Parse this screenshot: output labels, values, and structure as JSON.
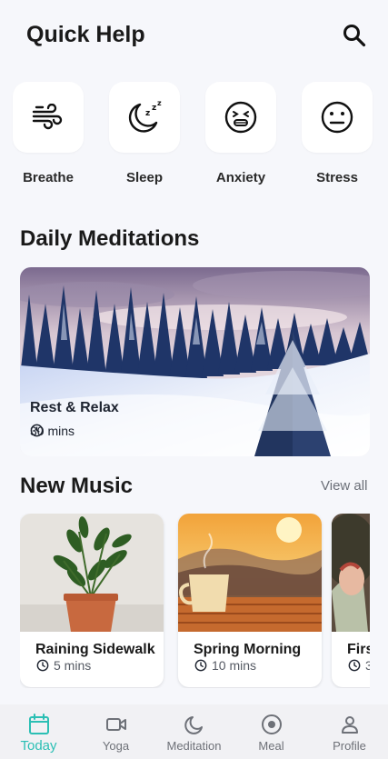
{
  "header": {
    "title": "Quick Help",
    "search_icon": "search-icon"
  },
  "quick_help": [
    {
      "label": "Breathe",
      "icon": "wind-icon"
    },
    {
      "label": "Sleep",
      "icon": "moon-zzz-icon"
    },
    {
      "label": "Anxiety",
      "icon": "anxious-face-icon"
    },
    {
      "label": "Stress",
      "icon": "neutral-face-icon"
    }
  ],
  "daily": {
    "title": "Daily Meditations",
    "card": {
      "title": "Rest & Relax",
      "duration": "30 mins",
      "image": "snowy-forest"
    }
  },
  "music": {
    "title": "New Music",
    "view_all": "View all",
    "items": [
      {
        "title": "Raining Sidewalk",
        "duration": "5 mins",
        "image": "potted-plant"
      },
      {
        "title": "Spring Morning",
        "duration": "10 mins",
        "image": "coffee-sunrise"
      },
      {
        "title": "Firs",
        "duration": "3",
        "image": "hands"
      }
    ]
  },
  "nav": {
    "active_color": "#2bbfb4",
    "items": [
      {
        "label": "Today",
        "icon": "calendar-icon",
        "active": true
      },
      {
        "label": "Yoga",
        "icon": "video-icon",
        "active": false
      },
      {
        "label": "Meditation",
        "icon": "moon-icon",
        "active": false
      },
      {
        "label": "Meal",
        "icon": "target-icon",
        "active": false
      },
      {
        "label": "Profile",
        "icon": "user-icon",
        "active": false
      }
    ]
  }
}
